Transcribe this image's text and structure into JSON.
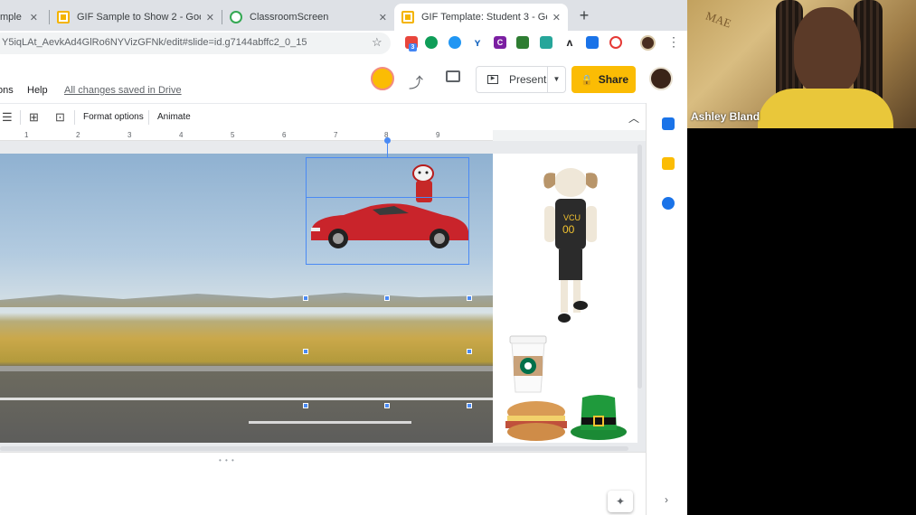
{
  "browser": {
    "tabs": [
      {
        "title": "mple -",
        "active": false
      },
      {
        "title": "GIF Sample to Show 2 - Google",
        "active": false
      },
      {
        "title": "ClassroomScreen",
        "active": false
      },
      {
        "title": "GIF Template: Student 3 - Goo",
        "active": true
      }
    ],
    "close_glyph": "✕",
    "new_tab_glyph": "+",
    "url": "Y5iqLAt_AevkAd4GlRo6NYVizGFNk/edit#slide=id.g7144abffc2_0_15",
    "extension_badge": "3"
  },
  "app": {
    "menu_items": [
      "ons",
      "Help"
    ],
    "save_status": "All changes saved in Drive",
    "present_label": "Present",
    "share_label": "Share"
  },
  "toolbar": {
    "format_options_label": "Format options",
    "animate_label": "Animate"
  },
  "ruler": {
    "ticks": [
      "1",
      "2",
      "3",
      "4",
      "5",
      "6",
      "7",
      "8",
      "9"
    ]
  },
  "webcam": {
    "participant_name": "Ashley Bland",
    "banner_text": "MAE"
  },
  "icons": {
    "present": "present-icon",
    "share": "lock-icon",
    "activity": "trending-icon",
    "comments": "comment-icon",
    "explore": "explore-icon"
  },
  "colors": {
    "share_button": "#fbbc04",
    "selection": "#4a8af4",
    "car": "#c9242b",
    "hat": "#1f9a3c"
  }
}
